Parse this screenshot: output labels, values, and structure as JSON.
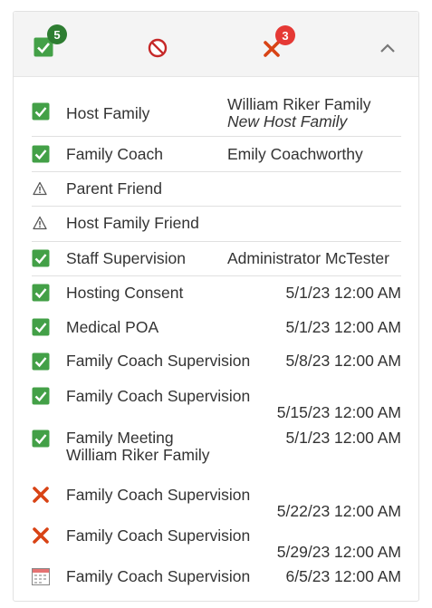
{
  "summary": {
    "complete_count": "5",
    "failed_count": "3"
  },
  "colors": {
    "complete": "#43a047",
    "failed": "#d32f2f",
    "blocked": "#c62828"
  },
  "items": [
    {
      "status": "check-icon",
      "label": "Host Family",
      "value": "William Riker Family",
      "sub": "New Host Family"
    },
    {
      "status": "check-icon",
      "label": "Family Coach",
      "value": "Emily Coachworthy"
    },
    {
      "status": "warning-icon",
      "label": "Parent Friend"
    },
    {
      "status": "warning-icon",
      "label": "Host Family Friend"
    },
    {
      "status": "check-icon",
      "label": "Staff Supervision",
      "value": "Administrator McTester"
    },
    {
      "status": "check-icon",
      "label": "Hosting Consent",
      "value": "5/1/23 12:00 AM"
    },
    {
      "status": "check-icon",
      "label": "Medical POA",
      "value": "5/1/23 12:00 AM"
    },
    {
      "status": "check-icon",
      "label": "Family Coach Supervision",
      "value": "5/8/23 12:00 AM"
    },
    {
      "status": "check-icon",
      "label": "Family Coach Supervision",
      "value": "5/15/23 12:00 AM"
    },
    {
      "status": "check-icon",
      "label": "Family Meeting",
      "sub": "William Riker Family",
      "value": "5/1/23 12:00 AM"
    },
    {
      "status": "x-icon",
      "label": "Family Coach Supervision",
      "value": "5/22/23 12:00 AM"
    },
    {
      "status": "x-icon",
      "label": "Family Coach Supervision",
      "value": "5/29/23 12:00 AM"
    },
    {
      "status": "calendar-icon",
      "label": "Family Coach Supervision",
      "value": "6/5/23 12:00 AM"
    }
  ]
}
